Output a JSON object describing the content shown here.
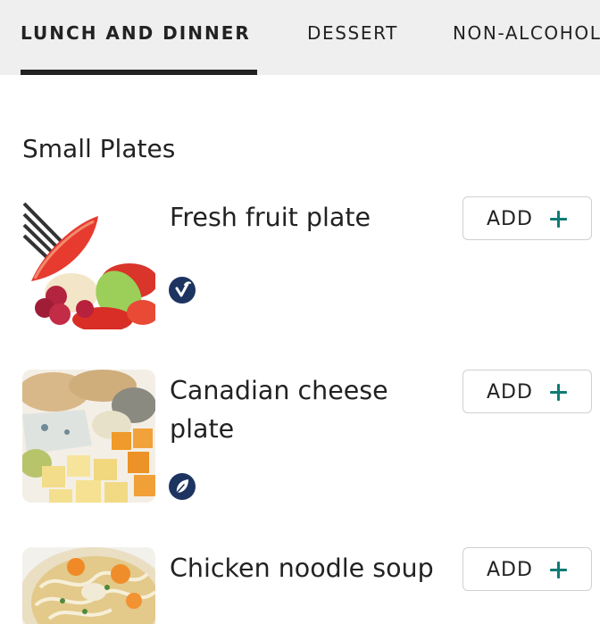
{
  "tabs": [
    {
      "label": "LUNCH AND DINNER",
      "active": true
    },
    {
      "label": "DESSERT",
      "active": false
    },
    {
      "label": "NON-ALCOHOLIC",
      "active": false
    }
  ],
  "section": {
    "title": "Small Plates"
  },
  "items": [
    {
      "name": "Fresh fruit plate",
      "button_label": "ADD",
      "badge_icon": "vegan-check-icon"
    },
    {
      "name": "Canadian cheese plate",
      "button_label": "ADD",
      "badge_icon": "vegetarian-leaf-icon"
    },
    {
      "name": "Chicken noodle soup",
      "button_label": "ADD"
    }
  ],
  "colors": {
    "tabbar_background": "#efefef",
    "badge_navy": "#1d3461",
    "plus_teal": "#0e7c73",
    "text": "#222222"
  }
}
